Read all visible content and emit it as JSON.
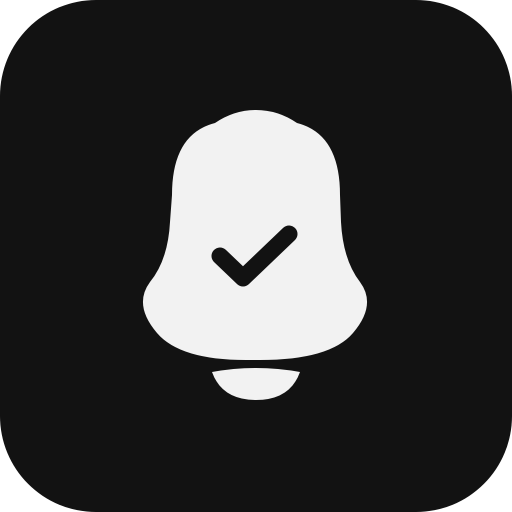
{
  "icon": {
    "name": "bell-check-icon",
    "background_color": "#121212",
    "glyph_color": "#F2F2F2",
    "check_color": "#121212"
  }
}
